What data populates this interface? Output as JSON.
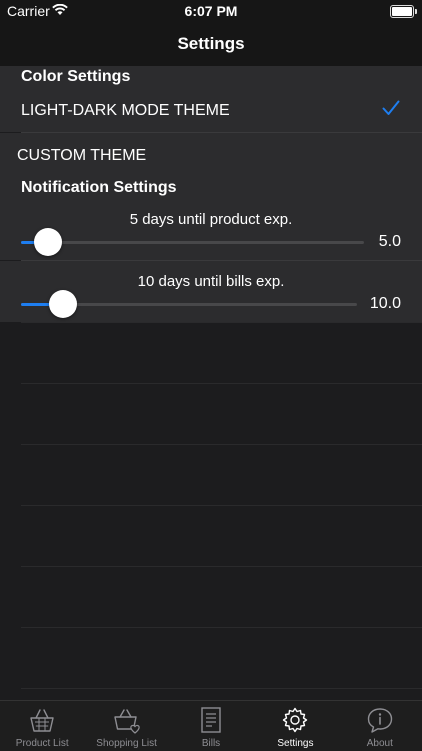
{
  "status": {
    "carrier": "Carrier",
    "time": "6:07 PM"
  },
  "nav": {
    "title": "Settings"
  },
  "color_settings": {
    "header": "Color Settings",
    "items": [
      {
        "label": "LIGHT-DARK MODE THEME",
        "selected": true
      },
      {
        "label": "CUSTOM THEME",
        "selected": false
      }
    ]
  },
  "notification_settings": {
    "header": "Notification Settings",
    "sliders": [
      {
        "title": "5 days until product exp.",
        "value_text": "5.0",
        "fill_fraction": 0.08
      },
      {
        "title": "10 days until bills exp.",
        "value_text": "10.0",
        "fill_fraction": 0.13
      }
    ]
  },
  "tabs": [
    {
      "label": "Product List",
      "icon": "basket-icon"
    },
    {
      "label": "Shopping List",
      "icon": "shopping-basket-heart-icon"
    },
    {
      "label": "Bills",
      "icon": "receipt-icon"
    },
    {
      "label": "Settings",
      "icon": "gear-icon",
      "active": true
    },
    {
      "label": "About",
      "icon": "info-icon"
    }
  ],
  "colors": {
    "accent": "#1e7ef0",
    "background": "#1c1c1e",
    "row": "#2c2c2e"
  }
}
